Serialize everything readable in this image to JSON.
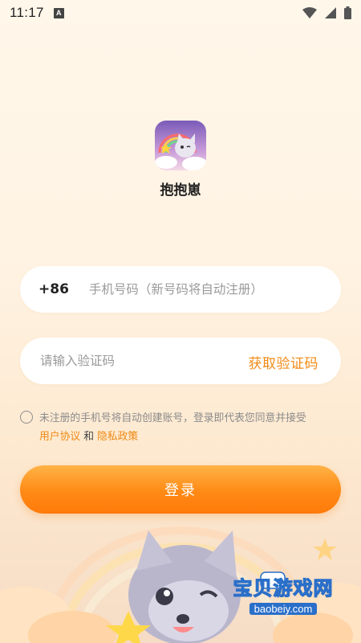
{
  "status": {
    "time": "11:17",
    "notif_letter": "A",
    "icons": [
      "wifi-icon",
      "signal-icon",
      "battery-icon"
    ]
  },
  "app": {
    "name": "抱抱崽",
    "icon": "app-logo-cat-rainbow"
  },
  "phone": {
    "country_code": "+86",
    "placeholder": "手机号码（新号码将自动注册）"
  },
  "code": {
    "placeholder": "请输入验证码",
    "get_code_label": "获取验证码"
  },
  "agreement": {
    "text": "未注册的手机号将自动创建账号，登录即代表您同意并接受",
    "user_agreement": "用户协议",
    "and": "和",
    "privacy_policy": "隐私政策"
  },
  "login": {
    "label": "登录"
  },
  "watermark": {
    "title": "宝贝游戏网",
    "url": "baobeiy.com"
  },
  "colors": {
    "accent": "#f08a14",
    "button_gradient_top": "#ffb347",
    "button_gradient_bottom": "#ff7a0a",
    "background": "#fff5e6"
  }
}
